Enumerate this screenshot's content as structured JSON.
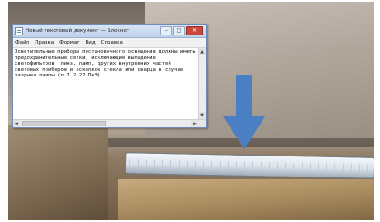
{
  "window": {
    "title": "Новый текстовый документ — Блокнот",
    "buttons": {
      "minimize": "–",
      "maximize": "□",
      "close": "✕"
    }
  },
  "menu": {
    "items": [
      "Файл",
      "Правка",
      "Формат",
      "Вид",
      "Справка"
    ]
  },
  "editor": {
    "text": "Осветительные приборы постановочного освещения должны иметь предохранительные сетки, исключающие выпадение светофильтров, линз, ламп, других внутренних частей световых приборов и осколков стекла или кварца в случае разрыва лампы.(п.7.2.27 ПкЭ)"
  },
  "scroll": {
    "up": "▲",
    "down": "▼",
    "left": "◄",
    "right": "►"
  },
  "photo": {
    "arrow_color": "#4a7fc4",
    "icon": "down-arrow-icon"
  }
}
